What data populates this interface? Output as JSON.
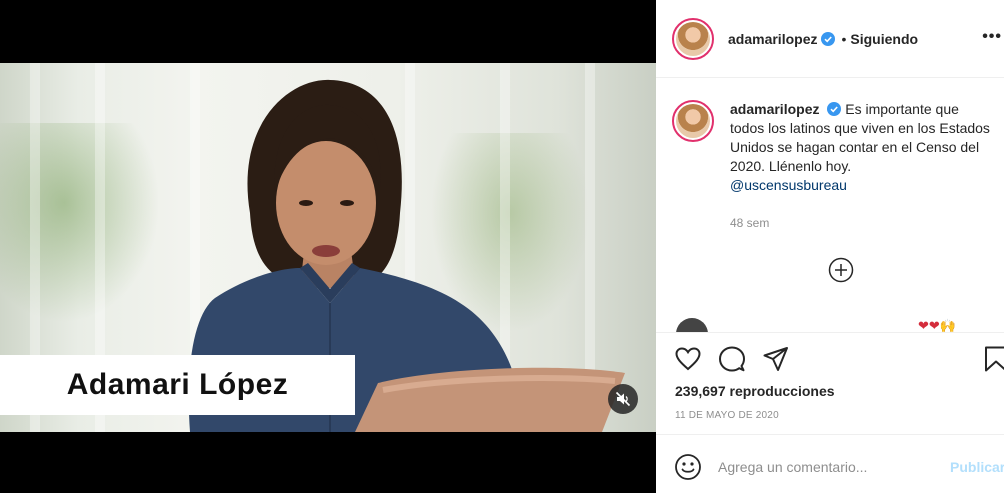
{
  "video": {
    "caption": "Adamari López",
    "mute_icon": "speaker-muted-icon"
  },
  "header": {
    "username": "adamarilopez",
    "separator": "•",
    "follow_status": "Siguiendo",
    "more_icon": "more-options-icon"
  },
  "post": {
    "username": "adamarilopez",
    "caption": "Es importante que todos los latinos que viven en los Estados Unidos se hagan contar en el Censo del 2020. Llénenlo hoy.",
    "mention": "@uscensusbureau",
    "time_ago": "48 sem",
    "load_more_icon": "plus-circle-icon"
  },
  "next_comment": {
    "hearts": "❤❤🙌"
  },
  "actions": {
    "views_count": "239,697",
    "views_label": "reproducciones",
    "date": "11 DE MAYO DE 2020"
  },
  "add_comment": {
    "placeholder": "Agrega un comentario...",
    "publish_label": "Publicar"
  },
  "colors": {
    "verified_blue": "#3897f0",
    "story_ring": "#e1306c",
    "mention": "#00376b",
    "publish_disabled": "#b2dffc",
    "muted_text": "#8e8e8e"
  }
}
